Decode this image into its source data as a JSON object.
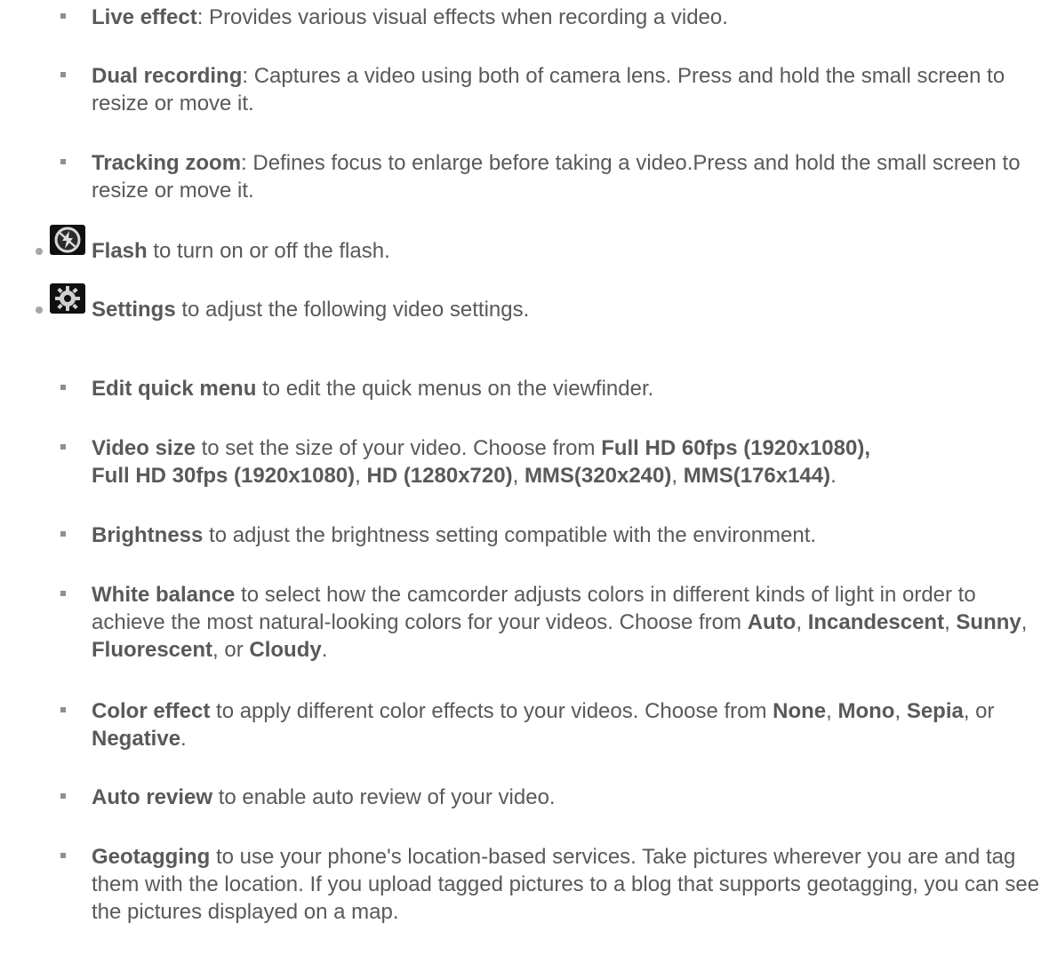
{
  "sub_top": [
    {
      "b": "Live effect",
      "t": ": Provides various visual effects when recording a video."
    },
    {
      "b": "Dual recording",
      "t": ": Captures a video using both of camera lens. Press and hold the small screen to resize or move it."
    },
    {
      "b": "Tracking zoom",
      "t": ": Defines focus to enlarge before taking a video.Press and hold the small screen to resize or move it."
    }
  ],
  "flash": {
    "icon": "flash-off-icon",
    "b": "Flash",
    "t": " to turn on or off the flash."
  },
  "settings": {
    "icon": "gear-icon",
    "b": "Settings",
    "t": " to adjust the following video settings."
  },
  "settings_items": {
    "edit_quick_menu": {
      "b": "Edit quick menu",
      "t": " to edit the quick menus on the viewfinder."
    },
    "video_size": {
      "b": "Video size",
      "t1": " to set the size of your video. Choose from ",
      "o1": "Full HD 60fps (1920x1080),",
      "sp": " ",
      "o2": "Full HD 30fps (1920x1080)",
      "c": ", ",
      "o3": "HD (1280x720)",
      "o4": "MMS(320x240)",
      "o5": "MMS(176x144)",
      "end": "."
    },
    "brightness": {
      "b": "Brightness",
      "t": " to adjust the brightness setting compatible with the environment."
    },
    "white_balance": {
      "b": "White balance",
      "t1": " to select how the camcorder adjusts colors in different kinds of light in order to achieve the most natural-looking colors for your videos. Choose from ",
      "o1": "Auto",
      "c": ", ",
      "o2": "Incandescent",
      "o3": "Sunny",
      "o4": "Fluorescent",
      "or": ", or ",
      "o5": "Cloudy",
      "end": "."
    },
    "color_effect": {
      "b": "Color effect",
      "t1": " to apply different color effects to your videos. Choose from ",
      "o1": "None",
      "c": ", ",
      "o2": "Mono",
      "o3": "Sepia",
      "or": ", or ",
      "o4": "Negative",
      "end": "."
    },
    "auto_review": {
      "b": "Auto review",
      "t": " to enable auto review of your video."
    },
    "geotagging": {
      "b": "Geotagging",
      "t": " to use your phone's location-based services. Take pictures wherever you are and tag them with the location. If you upload tagged pictures to a blog that supports geotagging, you can see the pictures displayed on a map."
    }
  }
}
